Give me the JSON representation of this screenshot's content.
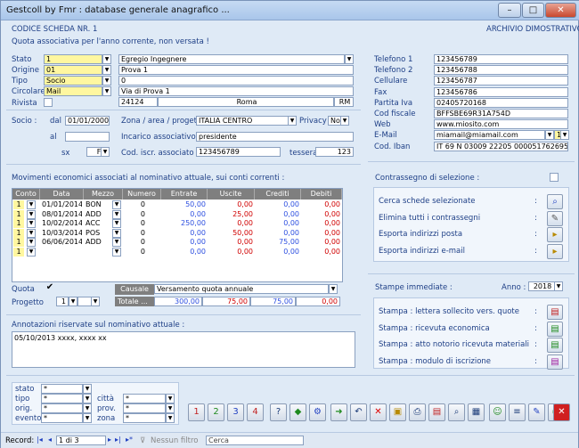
{
  "window": {
    "title": "Gestcoll by Fmr : database generale anagrafico ...",
    "min": "–",
    "max": "□",
    "close": "✕"
  },
  "header": {
    "code": "CODICE SCHEDA NR. 1",
    "archive": "ARCHIVIO DIMOSTRATIVO",
    "notice": "Quota associativa per l'anno corrente, non versata !"
  },
  "left_fields": {
    "stato": {
      "label": "Stato",
      "code": "1",
      "value": "Egregio Ingegnere"
    },
    "origine": {
      "label": "Origine",
      "code": "01",
      "value": "Prova 1"
    },
    "tipo": {
      "label": "Tipo",
      "code": "Socio",
      "value": "0"
    },
    "circolare": {
      "label": "Circolare",
      "code": "Mail",
      "value": "Via di Prova 1"
    },
    "rivista": {
      "label": "Rivista"
    },
    "cap": "24124",
    "city": "Roma",
    "prov": "RM"
  },
  "socio": {
    "label": "Socio :",
    "dal_label": "dal",
    "dal": "01/01/2000",
    "al_label": "al",
    "al": "",
    "sx_label": "sx",
    "sx": "F",
    "zona_label": "Zona / area / progetto",
    "zona": "ITALIA CENTRO",
    "privacy_label": "Privacy",
    "privacy": "No",
    "incarico_label": "Incarico associativo",
    "incarico": "presidente",
    "iscr_label": "Cod. iscr. associato",
    "iscr": "123456789",
    "tessera_label": "tessera",
    "tessera": "123"
  },
  "contacts": [
    {
      "label": "Telefono 1",
      "value": "123456789"
    },
    {
      "label": "Telefono 2",
      "value": "123456788"
    },
    {
      "label": "Cellulare",
      "value": "123456787"
    },
    {
      "label": "Fax",
      "value": "123456786"
    },
    {
      "label": "Partita Iva",
      "value": "02405720168"
    },
    {
      "label": "Cod fiscale",
      "value": "BFFSBE69R31A754D"
    },
    {
      "label": "Web",
      "value": "www.miosito.com"
    },
    {
      "label": "E-Mail",
      "value": "miamail@miamail.com",
      "num": "1"
    },
    {
      "label": "Cod. Iban",
      "value": "IT 69 N 03009 22205 000051762695"
    }
  ],
  "movimenti": {
    "title": "Movimenti economici associati al nominativo attuale, sui conti correnti :",
    "headers": [
      "Conto",
      "Data",
      "Mezzo",
      "Numero",
      "Entrate",
      "Uscite",
      "Crediti",
      "Debiti"
    ],
    "rows": [
      [
        "1",
        "01/01/2014",
        "BON",
        "0",
        "50,00",
        "0,00",
        "0,00",
        "0,00"
      ],
      [
        "1",
        "08/01/2014",
        "ADD",
        "0",
        "0,00",
        "25,00",
        "0,00",
        "0,00"
      ],
      [
        "1",
        "10/02/2014",
        "ACC",
        "0",
        "250,00",
        "0,00",
        "0,00",
        "0,00"
      ],
      [
        "1",
        "10/03/2014",
        "POS",
        "0",
        "0,00",
        "50,00",
        "0,00",
        "0,00"
      ],
      [
        "1",
        "06/06/2014",
        "ADD",
        "0",
        "0,00",
        "0,00",
        "75,00",
        "0,00"
      ],
      [
        "1",
        "",
        "",
        "0",
        "0,00",
        "0,00",
        "0,00",
        "0,00"
      ]
    ],
    "totale_label": "Totale ...",
    "totals": [
      "300,00",
      "75,00",
      "75,00",
      "0,00"
    ],
    "quota_label": "Quota",
    "progetto_label": "Progetto",
    "progetto": "1",
    "causale_label": "Causale",
    "causale": "Versamento quota annuale"
  },
  "annotazioni": {
    "label": "Annotazioni riservate sul nominativo attuale :",
    "text": "05/10/2013 xxxx, xxxx xx"
  },
  "selezione": {
    "label": "Contrassegno di selezione :",
    "actions": [
      "Cerca schede selezionate",
      "Elimina tutti i contrassegni",
      "Esporta indirizzi posta",
      "Esporta indirizzi e-mail"
    ]
  },
  "stampe": {
    "label": "Stampe immediate :",
    "anno_label": "Anno :",
    "anno": "2018",
    "actions": [
      "Stampa : lettera sollecito vers. quote",
      "Stampa : ricevuta economica",
      "Stampa : atto notorio ricevuta materiali",
      "Stampa : modulo di iscrizione"
    ]
  },
  "filters": {
    "stato": "stato",
    "tipo": "tipo",
    "orig": "orig.",
    "evento": "evento",
    "citta": "città",
    "prov": "prov.",
    "zona": "zona",
    "value": "*"
  },
  "toolbar": {
    "num_buttons": [
      "1",
      "2",
      "3",
      "4"
    ]
  },
  "statusbar": {
    "record_label": "Record:",
    "record": "1 di 3",
    "nofilter": "Nessun filtro",
    "search": "Cerca"
  },
  "colors": {
    "accent": "#1e3f86",
    "yellow": "#fff7a0",
    "blue_value": "#2d4fe0",
    "red_value": "#d00000"
  }
}
